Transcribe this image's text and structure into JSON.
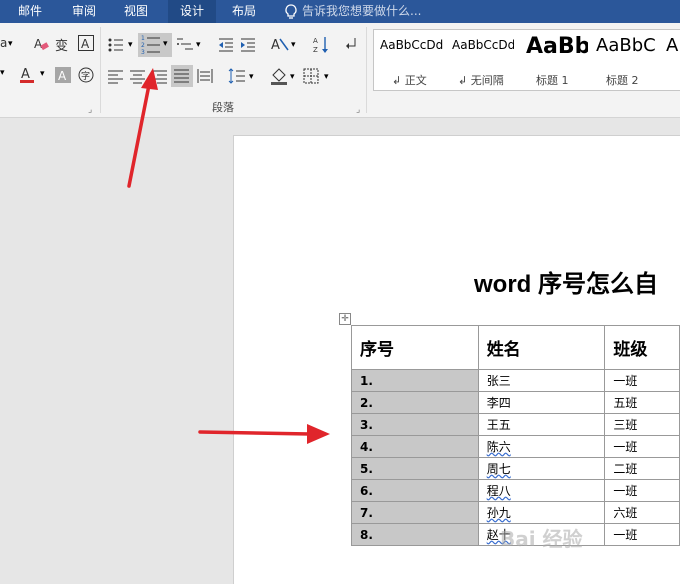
{
  "tabs": [
    "邮件",
    "审阅",
    "视图",
    "设计",
    "布局"
  ],
  "tell_me": "告诉我您想要做什么...",
  "ribbon": {
    "font_a_label": "a",
    "wen_label": "变",
    "paragraph_label": "段落",
    "zi_label": "字"
  },
  "styles": [
    {
      "preview": "AaBbCcDd",
      "name": "正文"
    },
    {
      "preview": "AaBbCcDd",
      "name": "无间隔"
    },
    {
      "preview": "AaBb",
      "name": "标题 1"
    },
    {
      "preview": "AaBbC",
      "name": "标题 2"
    },
    {
      "preview": "A",
      "name": ""
    }
  ],
  "document": {
    "title": "word 序号怎么自",
    "headers": [
      "序号",
      "姓名",
      "班级"
    ],
    "rows": [
      [
        "1.",
        "张三",
        "一班"
      ],
      [
        "2.",
        "李四",
        "五班"
      ],
      [
        "3.",
        "王五",
        "三班"
      ],
      [
        "4.",
        "陈六",
        "一班"
      ],
      [
        "5.",
        "周七",
        "二班"
      ],
      [
        "6.",
        "程八",
        "一班"
      ],
      [
        "7.",
        "孙九",
        "六班"
      ],
      [
        "8.",
        "赵十",
        "一班"
      ]
    ]
  },
  "watermark": "Bai 经验",
  "colors": {
    "title_bar": "#2b579a",
    "arrow": "#e0252b"
  }
}
